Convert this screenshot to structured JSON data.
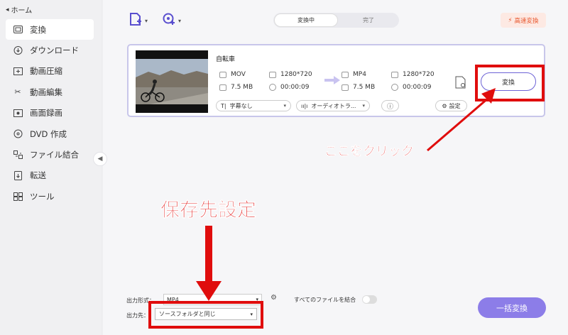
{
  "sidebar": {
    "home_label": "ホーム",
    "items": [
      {
        "label": "変換",
        "icon": "convert-icon",
        "active": true
      },
      {
        "label": "ダウンロード",
        "icon": "download-icon",
        "active": false
      },
      {
        "label": "動画圧縮",
        "icon": "compress-icon",
        "active": false
      },
      {
        "label": "動画編集",
        "icon": "scissors-icon",
        "active": false
      },
      {
        "label": "画面録画",
        "icon": "screen-record-icon",
        "active": false
      },
      {
        "label": "DVD 作成",
        "icon": "dvd-icon",
        "active": false
      },
      {
        "label": "ファイル結合",
        "icon": "merge-icon",
        "active": false
      },
      {
        "label": "転送",
        "icon": "transfer-icon",
        "active": false
      },
      {
        "label": "ツール",
        "icon": "toolbox-icon",
        "active": false
      }
    ]
  },
  "toolbar": {
    "tabs": [
      {
        "label": "変換中",
        "active": true
      },
      {
        "label": "完了",
        "active": false
      }
    ],
    "speed_label": "高速変換",
    "accent": "#5a4fcf",
    "speed_color": "#e8542a"
  },
  "file": {
    "name": "自転車",
    "source": {
      "format": "MOV",
      "resolution": "1280*720",
      "size": "7.5 MB",
      "duration": "00:00:09"
    },
    "target": {
      "format": "MP4",
      "resolution": "1280*720",
      "size": "7.5 MB",
      "duration": "00:00:09"
    },
    "subtitle_select": "字幕なし",
    "audio_select": "オーディオトラ...",
    "settings_label": "設定",
    "convert_label": "変換"
  },
  "bottom": {
    "format_label": "出力形式：",
    "format_value": "MP4",
    "merge_label": "すべてのファイルを結合",
    "merge_enabled": false,
    "dest_label": "出力先：",
    "dest_value": "ソースフォルダと同じ",
    "batch_label": "一括変換",
    "batch_color": "#8c7de8"
  },
  "annotations": {
    "click_here": "ここをクリック",
    "save_setting": "保存先設定",
    "color": "#e00d0d"
  }
}
